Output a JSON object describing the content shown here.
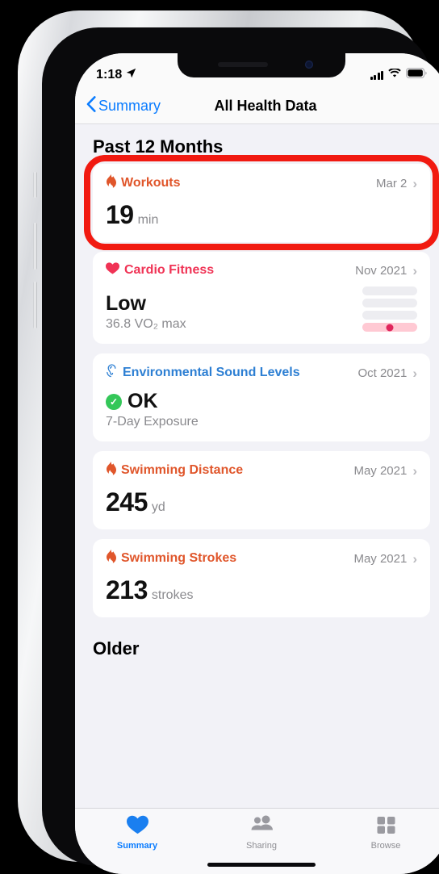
{
  "status_bar": {
    "time": "1:18",
    "location_icon": "location-arrow-icon",
    "signal_icon": "cellular-signal-icon",
    "wifi_icon": "wifi-icon",
    "battery_icon": "battery-icon"
  },
  "nav_bar": {
    "back_label": "Summary",
    "back_icon": "chevron-left-icon",
    "title": "All Health Data"
  },
  "sections": [
    {
      "title": "Past 12 Months"
    },
    {
      "title": "Older"
    }
  ],
  "cards": [
    {
      "title": "Workouts",
      "icon": "flame-icon",
      "color": "#e0562b",
      "date": "Mar 2",
      "value": "19",
      "unit": "min",
      "chevron": "›",
      "highlighted": true
    },
    {
      "title": "Cardio Fitness",
      "icon": "heart-icon",
      "color": "#f03355",
      "date": "Nov 2021",
      "value_word": "Low",
      "sub_text": "36.8 VO₂ max",
      "chevron": "›",
      "levels": {
        "count": 4,
        "active_index": 3,
        "active_color": "#ffc9d3",
        "inactive_color": "#ededf1",
        "dot_color": "#e0265c"
      }
    },
    {
      "title": "Environmental Sound Levels",
      "icon": "ear-icon",
      "color": "#2d7fd3",
      "date": "Oct 2021",
      "status_text": "OK",
      "status_icon": "checkmark-circle-icon",
      "status_color": "#34c759",
      "sub_text": "7-Day Exposure",
      "chevron": "›"
    },
    {
      "title": "Swimming Distance",
      "icon": "flame-icon",
      "color": "#e0562b",
      "date": "May 2021",
      "value": "245",
      "unit": "yd",
      "chevron": "›"
    },
    {
      "title": "Swimming Strokes",
      "icon": "flame-icon",
      "color": "#e0562b",
      "date": "May 2021",
      "value": "213",
      "unit": "strokes",
      "chevron": "›"
    }
  ],
  "tab_bar": {
    "items": [
      {
        "label": "Summary",
        "icon": "heart-filled-icon",
        "active": true
      },
      {
        "label": "Sharing",
        "icon": "people-icon",
        "active": false
      },
      {
        "label": "Browse",
        "icon": "grid-squares-icon",
        "active": false
      }
    ]
  },
  "annotation": {
    "color": "#f11a11",
    "target": "workouts-card"
  }
}
